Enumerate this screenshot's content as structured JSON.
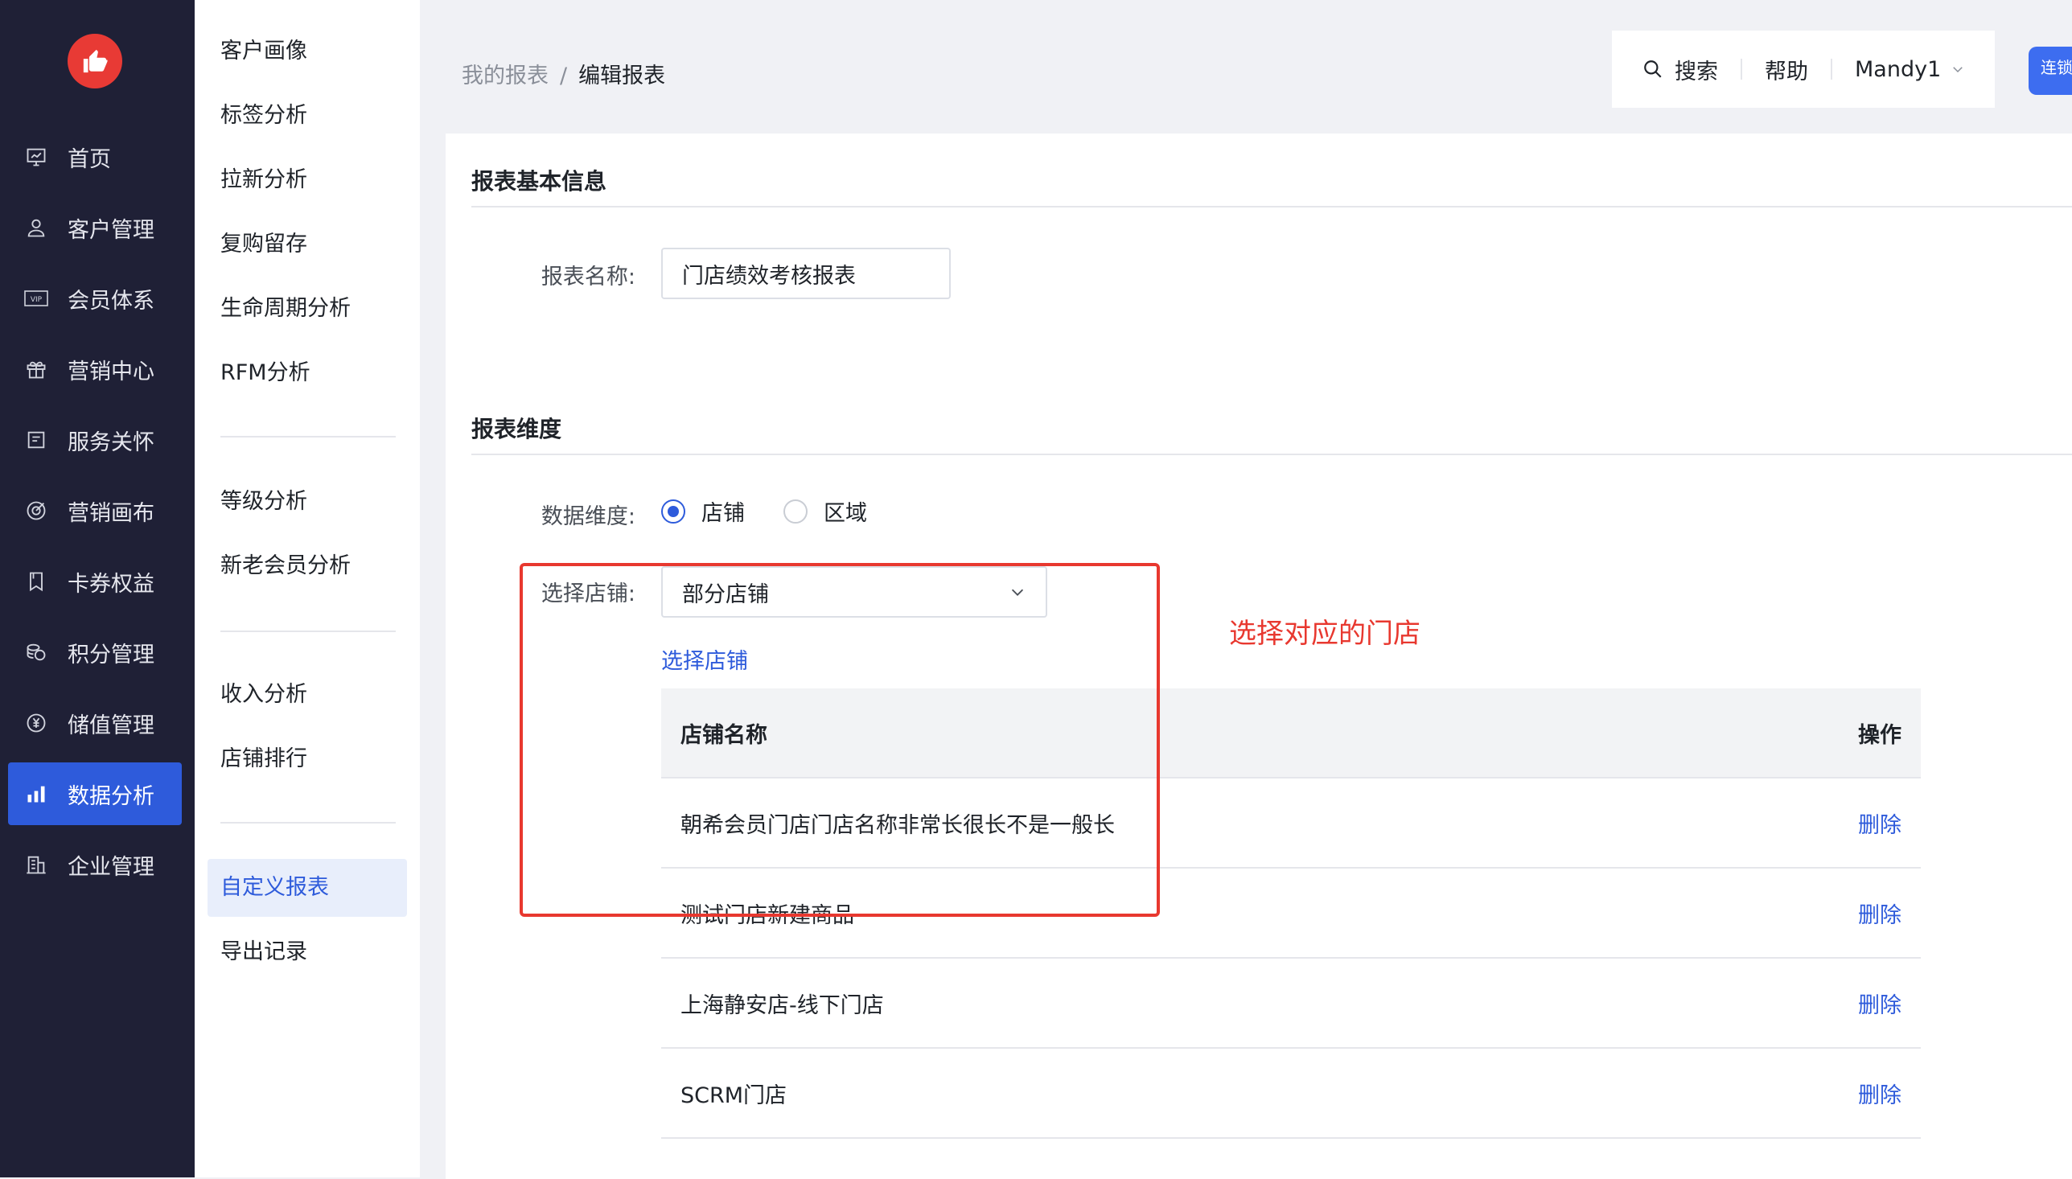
{
  "nav": {
    "items": [
      {
        "label": "首页",
        "icon": "dashboard-icon"
      },
      {
        "label": "客户管理",
        "icon": "user-icon"
      },
      {
        "label": "会员体系",
        "icon": "vip-icon"
      },
      {
        "label": "营销中心",
        "icon": "gift-icon"
      },
      {
        "label": "服务关怀",
        "icon": "message-icon"
      },
      {
        "label": "营销画布",
        "icon": "target-icon"
      },
      {
        "label": "卡券权益",
        "icon": "coupon-icon"
      },
      {
        "label": "积分管理",
        "icon": "coins-icon"
      },
      {
        "label": "储值管理",
        "icon": "yen-icon"
      },
      {
        "label": "数据分析",
        "icon": "bar-chart-icon"
      },
      {
        "label": "企业管理",
        "icon": "building-icon"
      }
    ],
    "active_index": 9
  },
  "submenu": {
    "group1": [
      "客户画像",
      "标签分析",
      "拉新分析",
      "复购留存",
      "生命周期分析",
      "RFM分析"
    ],
    "group2": [
      "等级分析",
      "新老会员分析"
    ],
    "group3": [
      "收入分析",
      "店铺排行"
    ],
    "group4": [
      "自定义报表",
      "导出记录"
    ],
    "active": "自定义报表"
  },
  "breadcrumb": {
    "parent": "我的报表",
    "separator": "/",
    "current": "编辑报表"
  },
  "topbar": {
    "search": "搜索",
    "help": "帮助",
    "user": "Mandy1",
    "app_badge": "连锁"
  },
  "form": {
    "basic_title": "报表基本信息",
    "name_label": "报表名称:",
    "name_value": "门店绩效考核报表",
    "dimension_title": "报表维度",
    "data_dim_label": "数据维度:",
    "radio_store": "店铺",
    "radio_region": "区域",
    "selected_radio": "店铺",
    "store_select_label": "选择店铺:",
    "store_select_value": "部分店铺",
    "select_store_link": "选择店铺"
  },
  "table": {
    "headers": {
      "name": "店铺名称",
      "op": "操作"
    },
    "rows": [
      {
        "name": "朝希会员门店门店名称非常长很长不是一般长",
        "op": "删除"
      },
      {
        "name": "测试门店新建商品",
        "op": "删除"
      },
      {
        "name": "上海静安店-线下门店",
        "op": "删除"
      },
      {
        "name": "SCRM门店",
        "op": "删除"
      }
    ]
  },
  "annotation": {
    "text": "选择对应的门店",
    "color": "#e8382f"
  },
  "colors": {
    "accent": "#2e5bdb",
    "nav_bg": "#1f2036",
    "logo": "#e83a35"
  }
}
